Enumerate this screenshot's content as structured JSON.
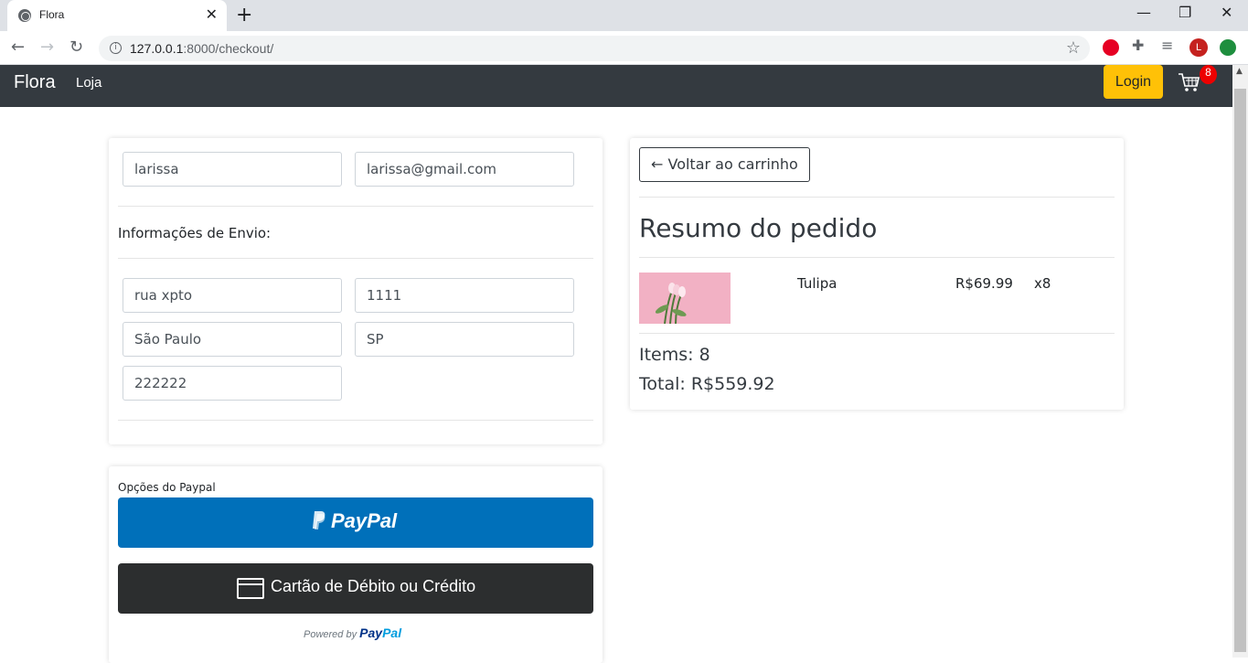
{
  "browser": {
    "tab_title": "Flora",
    "url_host": "127.0.0.1",
    "url_rest": ":8000/checkout/",
    "profile_initial": "L"
  },
  "navbar": {
    "brand": "Flora",
    "link_store": "Loja",
    "login_label": "Login",
    "cart_count": "8"
  },
  "form": {
    "name": "larissa",
    "email": "larissa@gmail.com",
    "shipping_heading": "Informações de Envio:",
    "address": "rua xpto",
    "number": "1111",
    "city": "São Paulo",
    "state": "SP",
    "zip": "222222"
  },
  "payment": {
    "options_label": "Opções do Paypal",
    "paypal_button": "PayPal",
    "card_button": "Cartão de Débito ou Crédito",
    "powered_by": "Powered by",
    "powered_brand_pay": "Pay",
    "powered_brand_pal": "Pal"
  },
  "summary": {
    "back_label": "← Voltar ao carrinho",
    "title": "Resumo do pedido",
    "items": [
      {
        "name": "Tulipa",
        "price": "R$69.99",
        "qty": "x8"
      }
    ],
    "items_total": "Items: 8",
    "total": "Total: R$559.92"
  },
  "colors": {
    "navbar_bg": "#343a40",
    "login_bg": "#ffc107",
    "paypal_blue": "#0070ba",
    "card_button_bg": "#2c2e2f",
    "badge_red": "#ee0000"
  }
}
